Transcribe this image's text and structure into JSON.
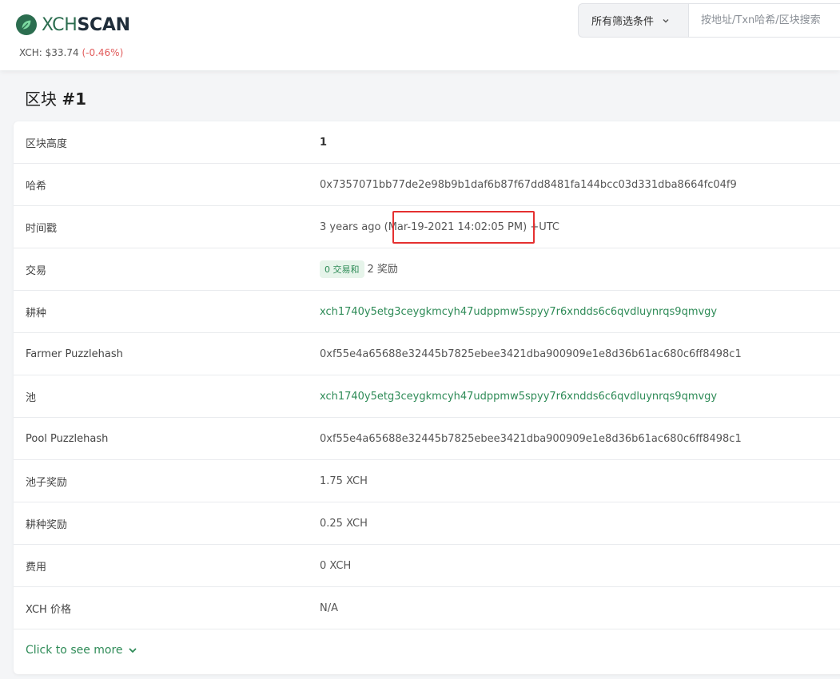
{
  "header": {
    "logo_xch": "XCH",
    "logo_scan": "SCAN",
    "price_label": "XCH: $33.74",
    "price_change": "(-0.46%)",
    "filter_label": "所有筛选条件",
    "search_placeholder": "按地址/Txn哈希/区块搜索"
  },
  "page": {
    "title_prefix": "区块",
    "title_number": "#1"
  },
  "details": {
    "height_label": "区块高度",
    "height_value": "1",
    "hash_label": "哈希",
    "hash_value": "0x7357071bb77de2e98b9b1daf6b87f67dd8481fa144bcc03d331dba8664fc04f9",
    "timestamp_label": "时间戳",
    "timestamp_ago": "3 years ago (",
    "timestamp_date": "Mar-19-2021 14:02:05 PM",
    "timestamp_suffix": ") +UTC",
    "tx_label": "交易",
    "tx_badge": "0 交易和",
    "tx_rewards": "2 奖励",
    "farmer_label": "耕种",
    "farmer_value": "xch1740y5etg3ceygkmcyh47udppmw5spyy7r6xndds6c6qvdluynrqs9qmvgy",
    "farmer_ph_label": "Farmer Puzzlehash",
    "farmer_ph_value": "0xf55e4a65688e32445b7825ebee3421dba900909e1e8d36b61ac680c6ff8498c1",
    "pool_label": "池",
    "pool_value": "xch1740y5etg3ceygkmcyh47udppmw5spyy7r6xndds6c6qvdluynrqs9qmvgy",
    "pool_ph_label": "Pool Puzzlehash",
    "pool_ph_value": "0xf55e4a65688e32445b7825ebee3421dba900909e1e8d36b61ac680c6ff8498c1",
    "pool_reward_label": "池子奖励",
    "pool_reward_value": "1.75 XCH",
    "farmer_reward_label": "耕种奖励",
    "farmer_reward_value": "0.25 XCH",
    "fee_label": "费用",
    "fee_value": "0 XCH",
    "price_label": "XCH 价格",
    "price_value": "N/A"
  },
  "more_link": "Click to see more",
  "colors": {
    "brand": "#2b6d4f",
    "link": "#2e8b57",
    "negative": "#e15b5b",
    "highlight": "#e53030"
  },
  "icons": {
    "logo": "leaf-logo-icon",
    "filter_chevron": "chevron-down-icon",
    "more_chevron": "chevron-down-icon"
  }
}
